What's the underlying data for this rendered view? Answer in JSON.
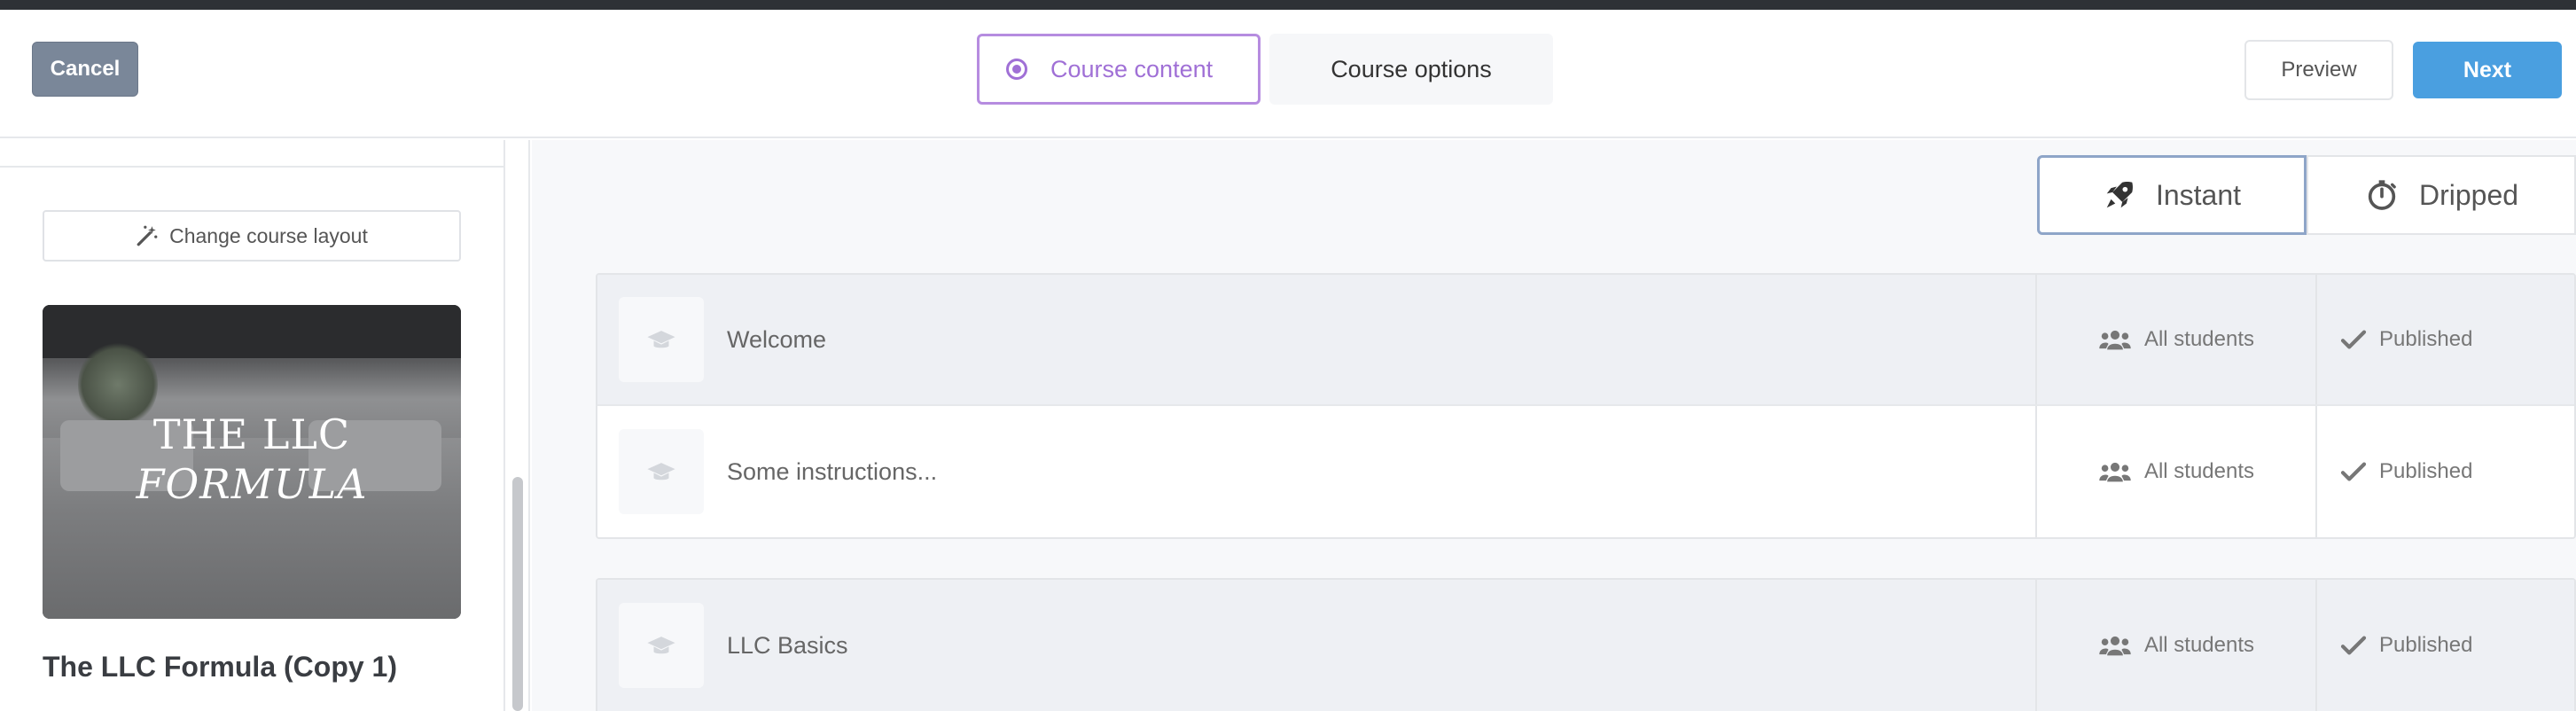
{
  "header": {
    "cancel_label": "Cancel",
    "tabs": [
      {
        "label": "Course content",
        "active": true
      },
      {
        "label": "Course options",
        "active": false
      }
    ],
    "preview_label": "Preview",
    "next_label": "Next"
  },
  "sidebar": {
    "change_layout_label": "Change course layout",
    "thumbnail": {
      "line1": "THE LLC",
      "line2": "FORMULA"
    },
    "course_title": "The LLC Formula (Copy 1)"
  },
  "release_toggle": [
    {
      "label": "Instant",
      "icon": "rocket-icon",
      "active": true
    },
    {
      "label": "Dripped",
      "icon": "stopwatch-icon",
      "active": false
    }
  ],
  "sections": [
    {
      "lessons": [
        {
          "title": "Welcome",
          "audience": "All students",
          "status": "Published",
          "shaded": true
        },
        {
          "title": "Some instructions...",
          "audience": "All students",
          "status": "Published",
          "shaded": false
        }
      ]
    },
    {
      "lessons": [
        {
          "title": "LLC Basics",
          "audience": "All students",
          "status": "Published",
          "shaded": true
        }
      ]
    }
  ],
  "colors": {
    "accent_purple": "#a070d6",
    "next_blue": "#4a9fe0",
    "cancel_gray": "#7a8799"
  }
}
